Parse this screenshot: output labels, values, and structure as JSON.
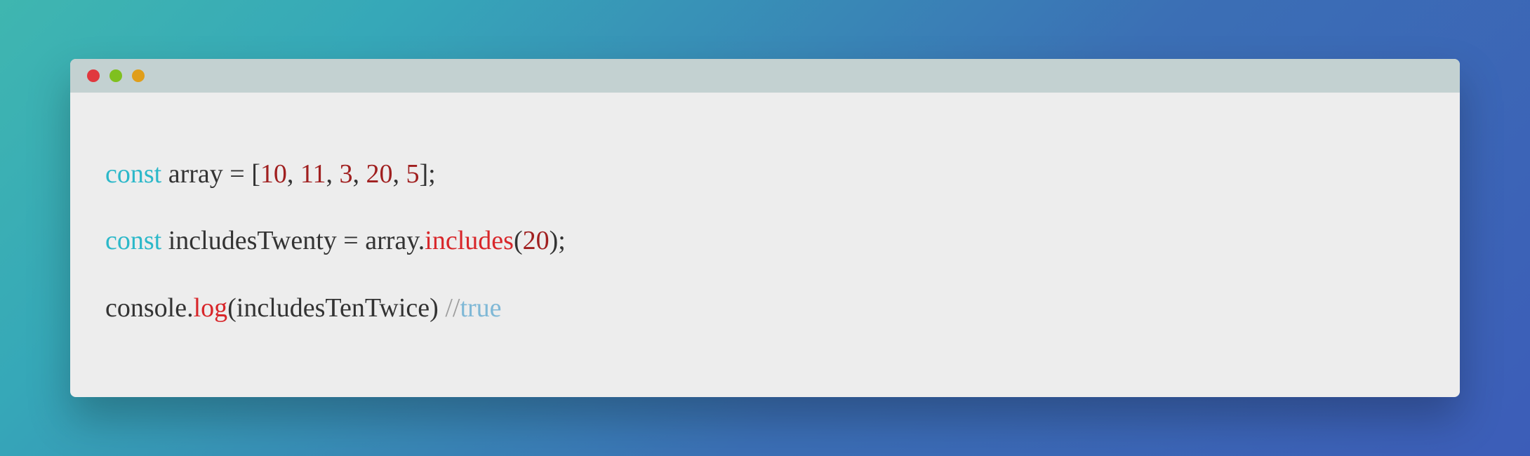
{
  "window": {
    "traffic_lights": {
      "red": "#e0383e",
      "yellow": "#e09e1a",
      "green": "#7fc01f"
    }
  },
  "code": {
    "lines": [
      [
        {
          "cls": "tok-keyword",
          "text": "const"
        },
        {
          "cls": "tok-default",
          "text": " array = ["
        },
        {
          "cls": "tok-number",
          "text": "10"
        },
        {
          "cls": "tok-default",
          "text": ", "
        },
        {
          "cls": "tok-number",
          "text": "11"
        },
        {
          "cls": "tok-default",
          "text": ", "
        },
        {
          "cls": "tok-number",
          "text": "3"
        },
        {
          "cls": "tok-default",
          "text": ", "
        },
        {
          "cls": "tok-number",
          "text": "20"
        },
        {
          "cls": "tok-default",
          "text": ", "
        },
        {
          "cls": "tok-number",
          "text": "5"
        },
        {
          "cls": "tok-default",
          "text": "];"
        }
      ],
      [
        {
          "cls": "tok-keyword",
          "text": "const"
        },
        {
          "cls": "tok-default",
          "text": " includesTwenty = array."
        },
        {
          "cls": "tok-method",
          "text": "includes"
        },
        {
          "cls": "tok-default",
          "text": "("
        },
        {
          "cls": "tok-number",
          "text": "20"
        },
        {
          "cls": "tok-default",
          "text": ");"
        }
      ],
      [
        {
          "cls": "tok-default",
          "text": "console."
        },
        {
          "cls": "tok-method",
          "text": "log"
        },
        {
          "cls": "tok-default",
          "text": "(includesTenTwice) "
        },
        {
          "cls": "tok-comment",
          "text": "//"
        },
        {
          "cls": "tok-bool",
          "text": "true"
        }
      ]
    ]
  }
}
